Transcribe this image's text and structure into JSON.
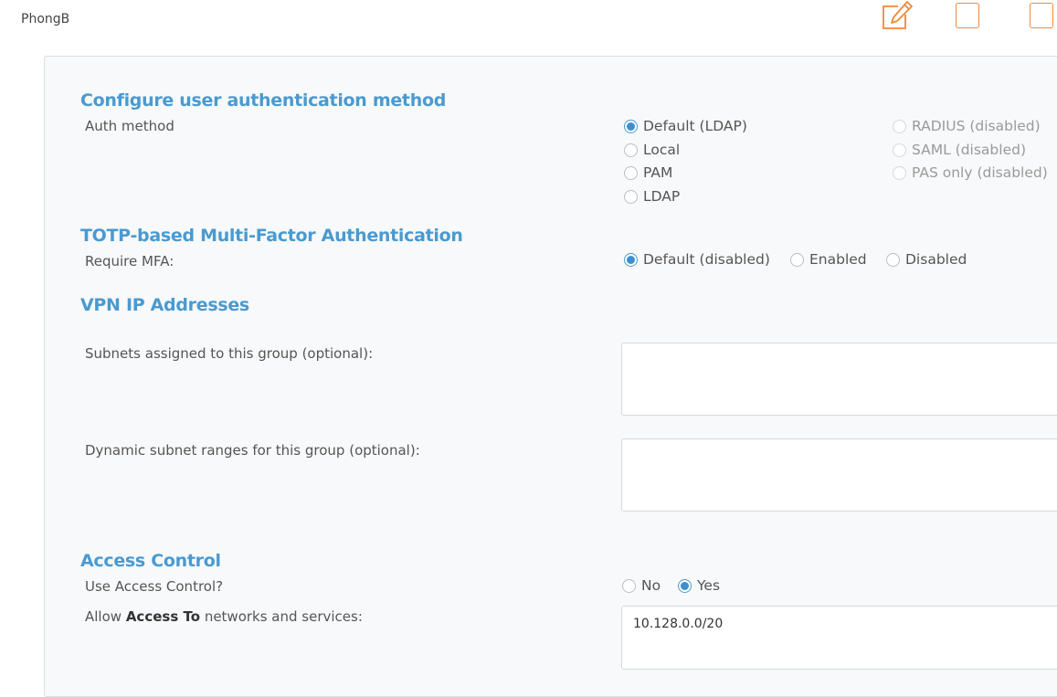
{
  "group": {
    "name": "PhongB"
  },
  "toolbar": {
    "edit_icon": "edit-icon",
    "accent_color": "#f0883a"
  },
  "auth": {
    "title": "Configure user authentication method",
    "label": "Auth method",
    "options": [
      {
        "label": "Default (LDAP)",
        "checked": true,
        "disabled": false
      },
      {
        "label": "Local",
        "checked": false,
        "disabled": false
      },
      {
        "label": "PAM",
        "checked": false,
        "disabled": false
      },
      {
        "label": "LDAP",
        "checked": false,
        "disabled": false
      },
      {
        "label": "RADIUS (disabled)",
        "checked": false,
        "disabled": true
      },
      {
        "label": "SAML (disabled)",
        "checked": false,
        "disabled": true
      },
      {
        "label": "PAS only (disabled)",
        "checked": false,
        "disabled": true
      }
    ]
  },
  "mfa": {
    "title": "TOTP-based Multi-Factor Authentication",
    "label": "Require MFA:",
    "options": [
      {
        "label": "Default (disabled)",
        "checked": true
      },
      {
        "label": "Enabled",
        "checked": false
      },
      {
        "label": "Disabled",
        "checked": false
      }
    ]
  },
  "vpn": {
    "title": "VPN IP Addresses",
    "subnets_label": "Subnets assigned to this group (optional):",
    "subnets_value": "",
    "dynamic_label": "Dynamic subnet ranges for this group (optional):",
    "dynamic_value": ""
  },
  "access": {
    "title": "Access Control",
    "use_label": "Use Access Control?",
    "options": [
      {
        "label": "No",
        "checked": false
      },
      {
        "label": "Yes",
        "checked": true
      }
    ],
    "allow_prefix": "Allow",
    "allow_bold": "Access To",
    "allow_suffix": "networks and services:",
    "allow_value": "10.128.0.0/20"
  },
  "colors": {
    "section_title": "#4a9ad0",
    "radio_checked": "#3d8fd0"
  }
}
